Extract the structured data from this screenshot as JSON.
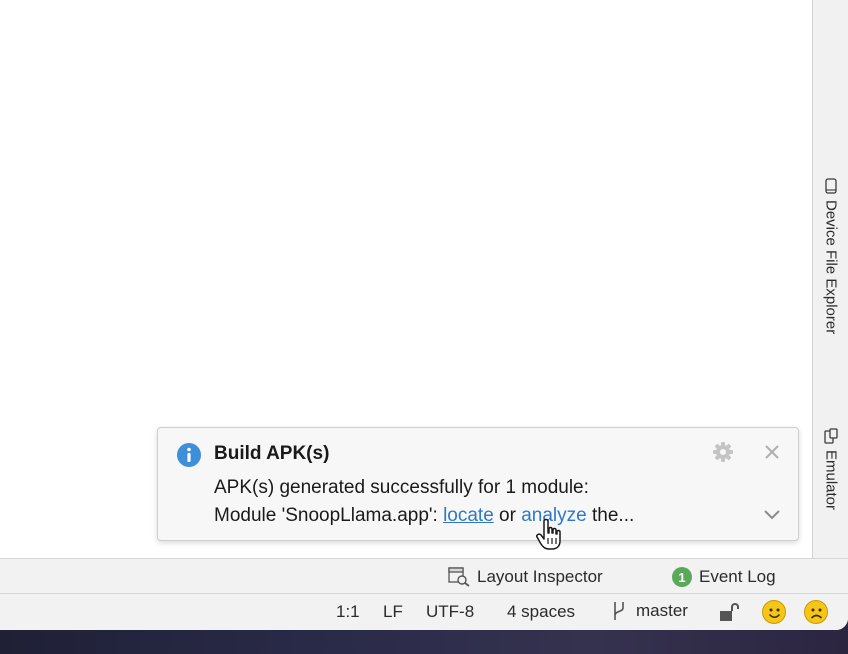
{
  "right_sidebar": {
    "device_file_explorer": "Device File Explorer",
    "emulator": "Emulator"
  },
  "notification": {
    "title": "Build APK(s)",
    "line1": "APK(s) generated successfully for 1 module:",
    "line2_prefix": "Module 'SnoopLlama.app': ",
    "locate_link": "locate",
    "or_text": " or ",
    "analyze_link": "analyze",
    "line2_suffix": " the..."
  },
  "tool_window_bar": {
    "layout_inspector": "Layout Inspector",
    "event_log": "Event Log",
    "event_log_count": "1"
  },
  "status_bar": {
    "position": "1:1",
    "line_separator": "LF",
    "encoding": "UTF-8",
    "indent": "4 spaces",
    "branch": "master"
  },
  "colors": {
    "link": "#2f78c8",
    "info_icon": "#3d8fd9",
    "badge": "#5aa95a",
    "smiley": "#f5c518"
  },
  "icons": [
    "device-icon",
    "emulator-icon",
    "info-icon",
    "gear-icon",
    "close-icon",
    "chevron-down-icon",
    "layout-inspector-icon",
    "git-branch-icon",
    "lock-icon",
    "happy-smiley-icon",
    "sad-smiley-icon",
    "hand-cursor-icon"
  ]
}
